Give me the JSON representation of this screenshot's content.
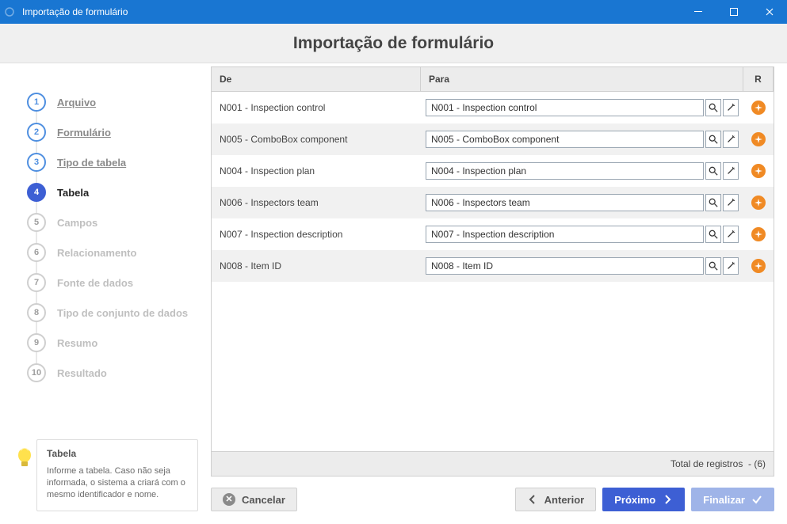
{
  "window": {
    "title": "Importação de formulário"
  },
  "header": {
    "title": "Importação de formulário"
  },
  "steps": [
    {
      "num": "1",
      "label": "Arquivo",
      "state": "done"
    },
    {
      "num": "2",
      "label": "Formulário",
      "state": "done"
    },
    {
      "num": "3",
      "label": "Tipo de tabela",
      "state": "done"
    },
    {
      "num": "4",
      "label": "Tabela",
      "state": "active"
    },
    {
      "num": "5",
      "label": "Campos",
      "state": "upcoming"
    },
    {
      "num": "6",
      "label": "Relacionamento",
      "state": "upcoming"
    },
    {
      "num": "7",
      "label": "Fonte de dados",
      "state": "upcoming"
    },
    {
      "num": "8",
      "label": "Tipo de conjunto de dados",
      "state": "upcoming"
    },
    {
      "num": "9",
      "label": "Resumo",
      "state": "upcoming"
    },
    {
      "num": "10",
      "label": "Resultado",
      "state": "upcoming"
    }
  ],
  "hint": {
    "title": "Tabela",
    "text": "Informe a tabela. Caso não seja informada, o sistema a criará com o mesmo identificador e nome."
  },
  "table": {
    "columns": {
      "de": "De",
      "para": "Para",
      "r": "R"
    },
    "rows": [
      {
        "de": "N001 - Inspection control",
        "para": "N001 - Inspection control"
      },
      {
        "de": "N005 - ComboBox component",
        "para": "N005 - ComboBox component"
      },
      {
        "de": "N004 - Inspection plan",
        "para": "N004 - Inspection plan"
      },
      {
        "de": "N006 - Inspectors team",
        "para": "N006 - Inspectors team"
      },
      {
        "de": "N007 - Inspection description",
        "para": "N007 - Inspection description"
      },
      {
        "de": "N008 - Item ID",
        "para": "N008 - Item ID"
      }
    ],
    "footer_label": "Total de registros",
    "footer_count": "(6)"
  },
  "actions": {
    "cancel": "Cancelar",
    "prev": "Anterior",
    "next": "Próximo",
    "finish": "Finalizar"
  }
}
